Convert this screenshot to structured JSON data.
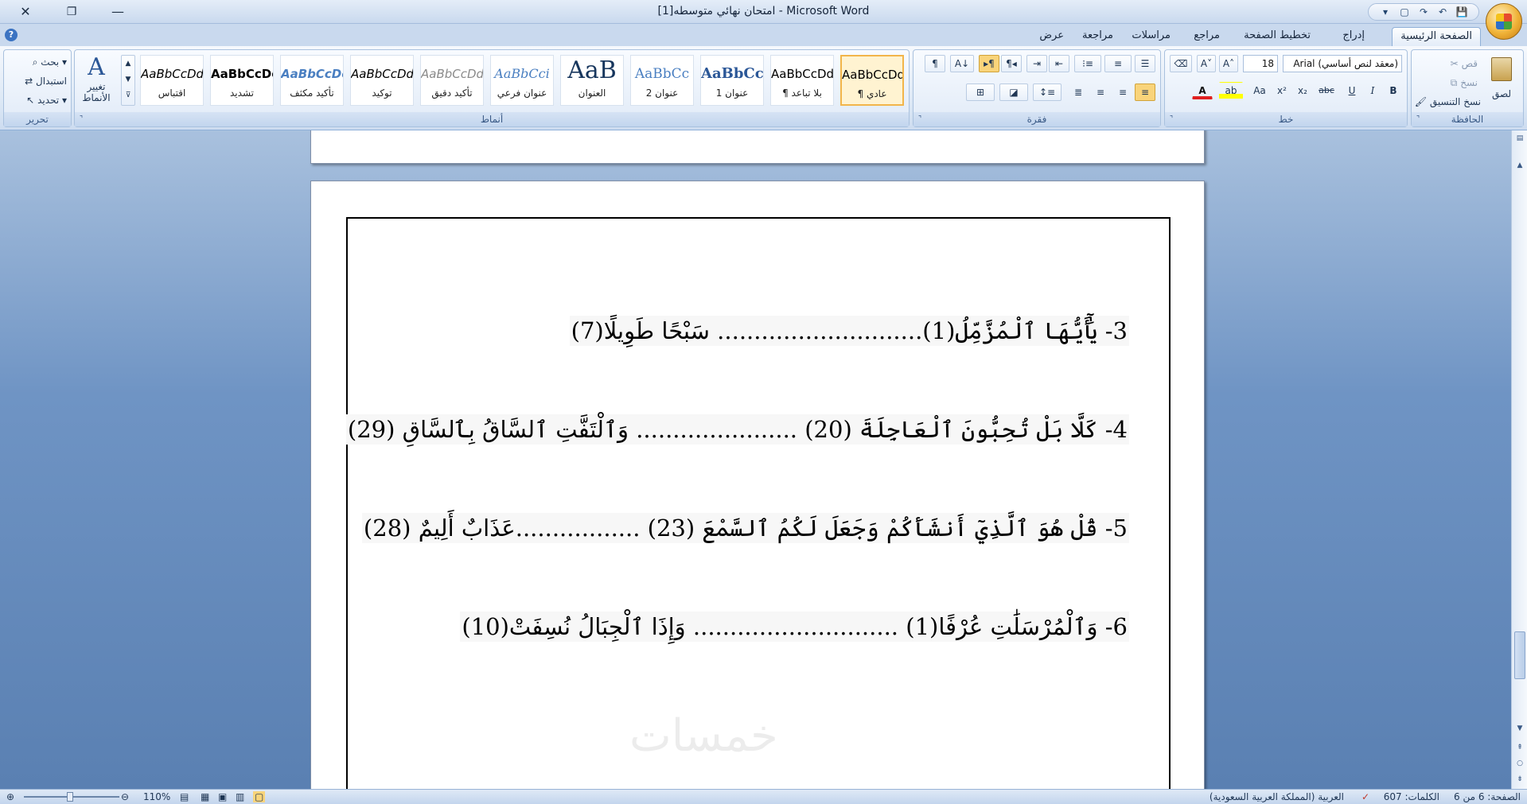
{
  "window": {
    "title": "امتحان نهائي متوسطه[1] - Microsoft Word",
    "close": "✕",
    "restore": "❐",
    "minimize": "—"
  },
  "qat": {
    "more": "▾",
    "new": "▢",
    "redo": "↷",
    "undo": "↶",
    "save": "💾"
  },
  "tabs": [
    {
      "label": "الصفحة الرئيسية",
      "active": true
    },
    {
      "label": "إدراج"
    },
    {
      "label": "تخطيط الصفحة"
    },
    {
      "label": "مراجع"
    },
    {
      "label": "مراسلات"
    },
    {
      "label": "مراجعة"
    },
    {
      "label": "عرض"
    }
  ],
  "clipboard": {
    "group": "الحافظة",
    "paste": "لصق",
    "cut": "قص",
    "copy": "نسخ",
    "format_painter": "نسخ التنسيق"
  },
  "font": {
    "group": "خط",
    "name": "Arial (معقد لنص أساسي)",
    "size": "18",
    "grow": "A˄",
    "shrink": "A˅",
    "clear": "⌫",
    "bold": "B",
    "italic": "I",
    "underline": "U",
    "strike": "abc",
    "subscript": "x₂",
    "superscript": "x²",
    "case": "Aa",
    "highlight": "ab",
    "color": "A"
  },
  "paragraph": {
    "group": "فقرة"
  },
  "styles": {
    "group": "أنماط",
    "items": [
      {
        "sample": "AaBbCcDd",
        "name": "¶ عادي",
        "selected": true
      },
      {
        "sample": "AaBbCcDd",
        "name": "¶ بلا تباعد"
      },
      {
        "sample": "AaBbCc",
        "name": "عنوان 1"
      },
      {
        "sample": "AaBbCc",
        "name": "عنوان 2"
      },
      {
        "sample": "AaB",
        "name": "العنوان"
      },
      {
        "sample": "AaBbCci",
        "name": "عنوان فرعي"
      },
      {
        "sample": "AaBbCcDd",
        "name": "تأكيد دقيق"
      },
      {
        "sample": "AaBbCcDd",
        "name": "توكيد"
      },
      {
        "sample": "AaBbCcDc",
        "name": "تأكيد مكثف"
      },
      {
        "sample": "AaBbCcDc",
        "name": "تشديد"
      },
      {
        "sample": "AaBbCcDd",
        "name": "اقتباس"
      }
    ],
    "change_styles": "تغيير الأنماط"
  },
  "editing": {
    "group": "تحرير",
    "find": "بحث",
    "replace": "استبدال",
    "select": "تحديد"
  },
  "document": {
    "lines": [
      "3- يَٰٓأَيُّهَا ٱلْمُزَّمِّلُ(1)............................ سَبْحًا طَوِيلًا(7)",
      "4- كَلَّا بَلْ تُحِبُّونَ ٱلْعَاجِلَةَ (20) ...................... وَٱلْتَفَّتِ ٱلسَّاقُ بِٱلسَّاقِ (29)",
      "5- قُلْ هُوَ ٱلَّذِيٓ أَنشَأَكُمْ وَجَعَلَ لَكُمُ ٱلسَّمْعَ (23) .................عَذَابٌ أَلِيمٌ (28)",
      "6-  وَٱلْمُرْسَلَٰتِ عُرْفًا(1) ............................ وَإِذَا ٱلْجِبَالُ نُسِفَتْ(10)"
    ],
    "watermark": "خمسات"
  },
  "status": {
    "page": "الصفحة: 6 من 6",
    "words": "الكلمات: 607",
    "language": "العربية (المملكة العربية السعودية)",
    "zoom": "110%"
  }
}
